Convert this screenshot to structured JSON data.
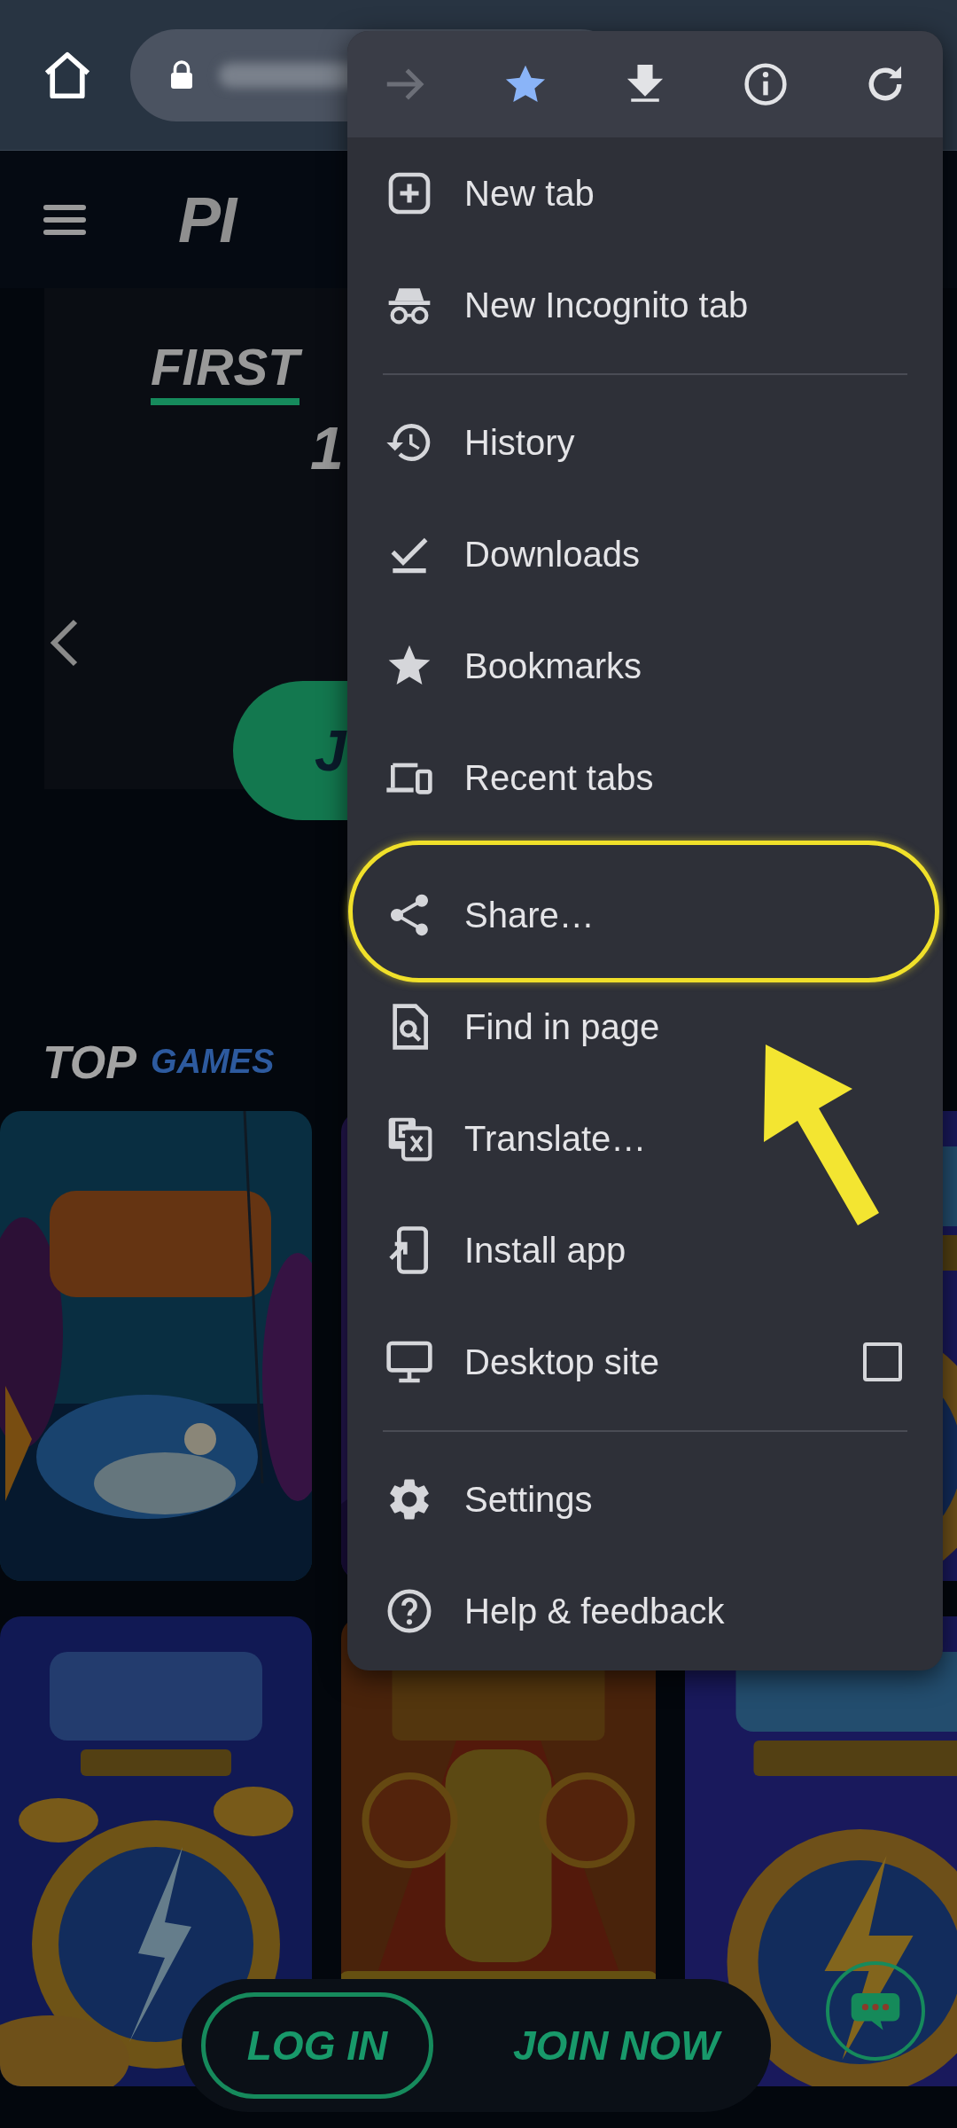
{
  "menu": {
    "actions": [
      {
        "kind": "forward",
        "disabled": true
      },
      {
        "kind": "bookmark",
        "disabled": false
      },
      {
        "kind": "download",
        "disabled": false
      },
      {
        "kind": "info",
        "disabled": false
      },
      {
        "kind": "reload",
        "disabled": false
      }
    ],
    "sections": [
      {
        "items": [
          {
            "kind": "new_tab",
            "label": "New tab",
            "highlighted": false
          },
          {
            "kind": "incognito",
            "label": "New Incognito tab",
            "highlighted": false
          }
        ]
      },
      {
        "divider": true,
        "items": [
          {
            "kind": "history",
            "label": "History",
            "highlighted": false
          },
          {
            "kind": "downloads",
            "label": "Downloads",
            "highlighted": false
          },
          {
            "kind": "bookmarks",
            "label": "Bookmarks",
            "highlighted": false
          },
          {
            "kind": "recent_tabs",
            "label": "Recent tabs",
            "highlighted": false
          }
        ]
      },
      {
        "divider": false,
        "items": [
          {
            "kind": "share",
            "label": "Share…",
            "highlighted": true
          },
          {
            "kind": "find",
            "label": "Find in page",
            "highlighted": false
          },
          {
            "kind": "translate",
            "label": "Translate…",
            "highlighted": false
          },
          {
            "kind": "install",
            "label": "Install app",
            "highlighted": false
          },
          {
            "kind": "desktop",
            "label": "Desktop site",
            "highlighted": false,
            "checkbox": {
              "checked": false
            }
          }
        ]
      },
      {
        "divider": true,
        "items": [
          {
            "kind": "settings",
            "label": "Settings",
            "highlighted": false
          },
          {
            "kind": "help",
            "label": "Help & feedback",
            "highlighted": false
          }
        ]
      }
    ]
  },
  "page": {
    "logo": "PI",
    "hero": {
      "title": "FIRST",
      "amount": "1",
      "button": "J"
    },
    "section_title": {
      "bold": "TOP",
      "accent": "GAMES"
    },
    "bottom_bar": {
      "login": "LOG IN",
      "join": "JOIN NOW"
    }
  }
}
